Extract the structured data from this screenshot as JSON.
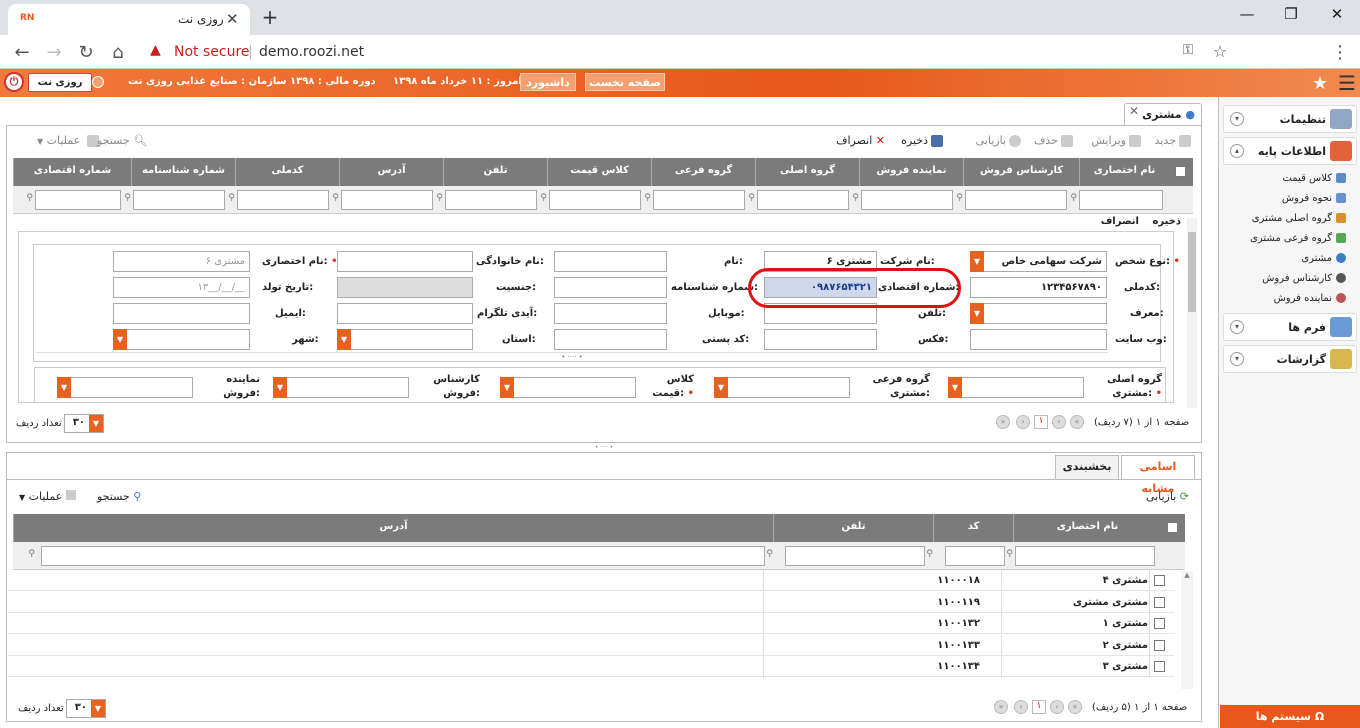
{
  "browser": {
    "tab_title": "روزی نت",
    "favicon_text": "RN",
    "not_secure": "Not secure",
    "url": "demo.roozi.net"
  },
  "app": {
    "brand": "روزی نت",
    "home_btn": "صفحه نخست",
    "dashboard_btn": "داشبورد",
    "today": "امروز : ۱۱ خرداد ماه ۱۳۹۸",
    "fiscal": "دوره مالی : ۱۳۹۸",
    "org": "سازمان : صنایع غذایی روزی نت"
  },
  "sidebar": {
    "settings": "تنظیمات",
    "base_info": "اطلاعات پایه",
    "items": [
      "کلاس قیمت",
      "نحوه فروش",
      "گروه اصلی مشتری",
      "گروه فرعی مشتری",
      "مشتری",
      "کارشناس فروش",
      "نماینده فروش"
    ],
    "forms": "فرم ها",
    "reports": "گزارشات",
    "system": "سیستم ها"
  },
  "panel": {
    "tab": "مشتری",
    "toolbar": {
      "new": "جدید",
      "edit": "ویرایش",
      "delete": "حذف",
      "refresh": "بازیابی",
      "save": "ذخیره",
      "cancel": "انصراف",
      "search": "جستجو",
      "ops": "عملیات"
    },
    "columns": [
      "نام اختصاری",
      "کارشناس فروش",
      "نماینده فروش",
      "گروه اصلی",
      "گروه فرعی",
      "کلاس قیمت",
      "تلفن",
      "آدرس",
      "کدملی",
      "شماره شناسنامه",
      "شماره اقتصادی"
    ],
    "subbar": {
      "save": "ذخیره",
      "cancel": "انصراف"
    }
  },
  "form": {
    "person_type_label": "نوع شخص:",
    "person_type": "شرکت سهامی خاص",
    "company_label": "نام شرکت:",
    "company": "مشتری ۶",
    "name_label": "نام:",
    "family_label": "نام خانوادگی:",
    "short_label": "نام اختصاری:",
    "short_name": "مشتری ۶",
    "national_label": "کدملی:",
    "national": "۱۲۳۴۵۶۷۸۹۰",
    "economic_label": "شماره اقتصادی:",
    "economic": "۰۹۸۷۶۵۴۳۲۱",
    "idno_label": "شماره شناسنامه:",
    "gender_label": "جنسیت:",
    "birth_label": "تاریخ تولد:",
    "birth_ph": "۱۳__/__/__",
    "referrer_label": "معرف:",
    "phone_label": "تلفن:",
    "mobile_label": "موبایل:",
    "telegram_label": "آیدی تلگرام:",
    "email_label": "ایمیل:",
    "website_label": "وب سایت:",
    "fax_label": "فکس:",
    "postal_label": "کد پستی:",
    "province_label": "استان:",
    "city_label": "شهر:",
    "main_group_label": "گروه اصلی مشتری:",
    "sub_group_label": "گروه فرعی مشتری:",
    "price_class_label": "کلاس قیمت:",
    "expert_label": "کارشناس فروش:",
    "agent_label": "نماینده فروش:"
  },
  "pager_top": {
    "text": "صفحه ۱ از ۱ (۷ ردیف)",
    "page": "۱",
    "rows": "۳۰",
    "rows_label": "تعداد ردیف"
  },
  "bottom": {
    "tabs": [
      "اسامی مشابه",
      "بخشبندی"
    ],
    "refresh": "بازیابی",
    "search": "جستجو",
    "ops": "عملیات",
    "columns": [
      "نام اختصاری",
      "کد",
      "تلفن",
      "آدرس"
    ],
    "rows": [
      {
        "name": "مشتری ۴",
        "code": "۱۱۰۰۰۱۸"
      },
      {
        "name": "مشتری مشتری",
        "code": "۱۱۰۰۱۱۹"
      },
      {
        "name": "مشتری ۱",
        "code": "۱۱۰۰۱۳۲"
      },
      {
        "name": "مشتری ۲",
        "code": "۱۱۰۰۱۳۳"
      },
      {
        "name": "مشتری ۳",
        "code": "۱۱۰۰۱۳۴"
      }
    ],
    "pager": {
      "text": "صفحه ۱ از ۱ (۵ ردیف)",
      "page": "۱",
      "rows": "۳۰",
      "rows_label": "تعداد ردیف"
    }
  }
}
